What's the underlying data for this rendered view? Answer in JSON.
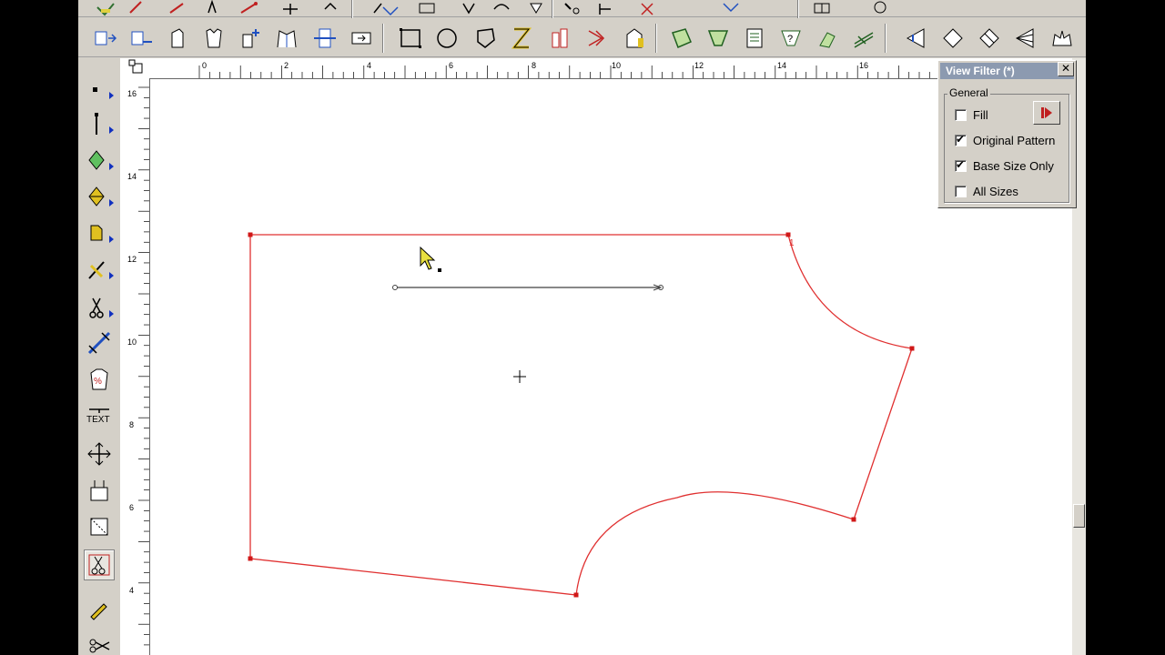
{
  "app": {
    "name": "pattern-design-cad",
    "colors": {
      "outline": "#e03030",
      "point": "#d01818",
      "chrome": "#d4d0c8",
      "panel_title": "#8c9ab0"
    }
  },
  "toolbar_top": {
    "icons": [
      "arrow-icon",
      "pencil-icon",
      "line-icon",
      "pin-icon",
      "vertex-icon",
      "tree-icon",
      "scale-icon",
      "add-point-icon",
      "grade-icon",
      "notch-icon",
      "seam-icon",
      "rotate-icon",
      "select-icon",
      "snap-icon",
      "measure-icon",
      "cross-icon",
      "vcross-icon",
      "grid-icon",
      "open-icon"
    ]
  },
  "toolbar_main": {
    "groups": [
      [
        "align-icon",
        "split-icon",
        "piece-icon",
        "shirt-icon",
        "add-piece-icon",
        "pleat-icon",
        "mirror-icon",
        "fold-icon"
      ],
      [
        "rect-icon",
        "circle-icon",
        "polygon-icon",
        "trace-icon",
        "sleeve-icon",
        "dart-icon",
        "tab-icon"
      ],
      [
        "tag-icon",
        "label-icon",
        "table-icon",
        "query-icon",
        "hand-icon",
        "hatch-icon"
      ],
      [
        "cone-icon",
        "ruler-diag-icon",
        "shear-icon",
        "fan-icon",
        "crown-icon"
      ]
    ]
  },
  "left_tools": [
    {
      "icon": "point-tool-icon",
      "flyout": true
    },
    {
      "icon": "line-tool-icon",
      "flyout": true
    },
    {
      "icon": "diamond-tool-icon",
      "flyout": true
    },
    {
      "icon": "fill-tool-icon",
      "flyout": true
    },
    {
      "icon": "page-tool-icon",
      "flyout": true
    },
    {
      "icon": "edit-tool-icon",
      "flyout": true
    },
    {
      "icon": "scissors-tool-icon",
      "flyout": true
    },
    {
      "icon": "chain-tool-icon",
      "flyout": false
    },
    {
      "icon": "grade-shirt-icon",
      "flyout": false
    },
    {
      "icon": "text-tool-icon",
      "flyout": false,
      "label": "TEXT"
    },
    {
      "icon": "move-tool-icon",
      "flyout": false
    },
    {
      "icon": "stack-tool-icon",
      "flyout": false
    },
    {
      "icon": "marker-tool-icon",
      "flyout": false
    },
    {
      "icon": "cut-piece-icon",
      "flyout": false,
      "active": true
    },
    {
      "icon": "pencil-tool-icon",
      "flyout": false
    },
    {
      "icon": "shears-icon",
      "flyout": false
    }
  ],
  "rulers": {
    "horizontal": [
      "0",
      "2",
      "4",
      "6",
      "8",
      "10",
      "12",
      "14",
      "16"
    ],
    "vertical": [
      "16",
      "14",
      "12",
      "10",
      "8",
      "6",
      "4"
    ]
  },
  "pattern": {
    "corner_label": "1"
  },
  "view_filter": {
    "title": "View Filter (*)",
    "close": "✕",
    "group_label": "General",
    "options": [
      {
        "label": "Fill",
        "checked": false
      },
      {
        "label": "Original Pattern",
        "checked": true
      },
      {
        "label": "Base Size Only",
        "checked": true
      },
      {
        "label": "All Sizes",
        "checked": false
      }
    ]
  }
}
